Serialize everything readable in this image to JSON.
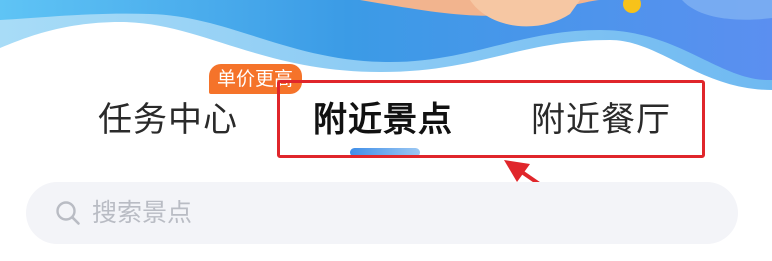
{
  "banner": {
    "illustration": "banner-illustration"
  },
  "tabs": [
    {
      "label": "任务中心",
      "active": false
    },
    {
      "label": "附近景点",
      "active": true
    },
    {
      "label": "附近餐厅",
      "active": false
    }
  ],
  "badge": {
    "label": "单价更高"
  },
  "search": {
    "placeholder": "搜索景点",
    "icon": "search-icon"
  },
  "colors": {
    "badge_bg": "#f5732a",
    "highlight_border": "#e0262b",
    "active_indicator": "#3f8ee8",
    "banner_blue": "#3b9be6"
  }
}
